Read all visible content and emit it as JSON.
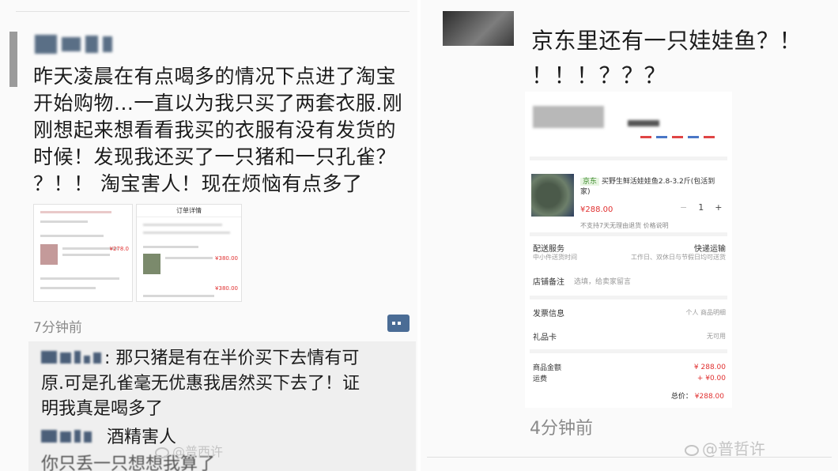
{
  "left_post": {
    "body_lines": [
      "昨天凌晨在有点喝多的情况下点进了淘宝",
      "开始购物...一直以为我只买了两套衣服.刚",
      "刚想起来想看看我买的衣服有没有发货的",
      "时候！发现我还买了一只猪和一只孔雀？",
      "？！！ 淘宝害人！现在烦恼有点多了"
    ],
    "time": "7分钟前",
    "comments": [
      {
        "text_lines": [
          ": 那只猪是有在半价买下去情有可",
          "原.可是孔雀毫无优惠我居然买下去了！证",
          "明我真是喝多了"
        ]
      },
      {
        "text_lines": [
          "酒精害人"
        ]
      }
    ],
    "partial_comment_tail": "你只丢一只想想我算了",
    "embedded_left": {
      "title": "订单详情",
      "price_a": "¥278.0",
      "price_b": "¥380.00",
      "price_c": "¥380.00"
    }
  },
  "right_post": {
    "body_lines": [
      "京东里还有一只娃娃鱼？！",
      "！！！？？？"
    ],
    "time": "4分钟前",
    "order": {
      "badge": "京东",
      "product_name": "买野生鲜活娃娃鱼2.8-3.2斤(包活到",
      "product_name_2": "家)",
      "price": "¥288.00",
      "quantity": "1",
      "minus": "−",
      "plus": "+",
      "service_notes": "不支持7天无理由退货  价格说明",
      "delivery_label": "配送服务",
      "delivery_value": "快递运输",
      "delivery_sub_left": "中小件送货时间",
      "delivery_sub_right": "工作日、双休日与节假日均可送货",
      "remark_label": "店铺备注",
      "remark_placeholder": "选填，给卖家留言",
      "invoice_label": "发票信息",
      "invoice_value": "个人 商品明细",
      "gift_label": "礼品卡",
      "gift_value": "无可用",
      "subtotal_label": "商品金额",
      "subtotal_value": "¥ 288.00",
      "shipping_label": "运费",
      "shipping_value": "+ ¥0.00",
      "total_label": "总价：",
      "total_value": "¥288.00"
    }
  },
  "watermarks": {
    "left": "@普西许",
    "right": "@普哲许"
  }
}
